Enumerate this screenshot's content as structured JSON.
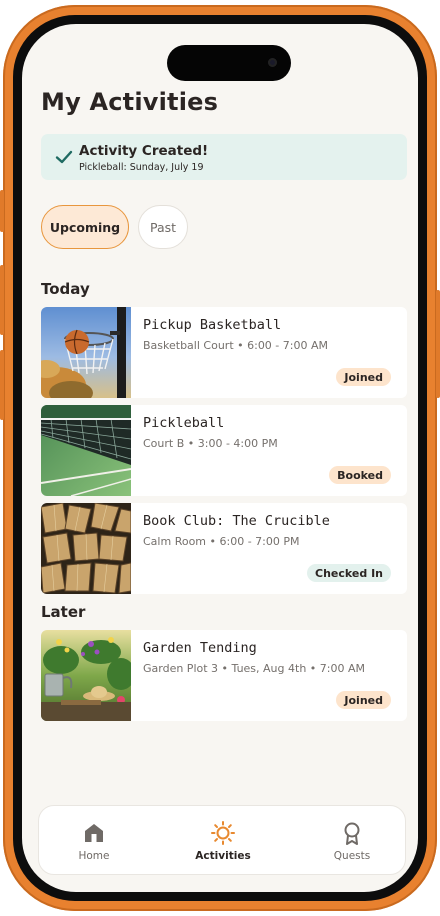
{
  "header": {
    "title": "My Activities"
  },
  "toast": {
    "title": "Activity Created!",
    "subtitle": "Pickleball: Sunday, July 19"
  },
  "filters": {
    "upcoming": "Upcoming",
    "past": "Past",
    "selected": "Upcoming"
  },
  "sections": {
    "today": {
      "label": "Today",
      "items": [
        {
          "title": "Pickup Basketball",
          "subtitle": "Basketball Court • 6:00 - 7:00 AM",
          "status": "Joined",
          "image_icon": "basketball-hoop"
        },
        {
          "title": "Pickleball",
          "subtitle": "Court B • 3:00 - 4:00 PM",
          "status": "Booked",
          "image_icon": "tennis-net"
        },
        {
          "title": "Book Club: The Crucible",
          "subtitle": "Calm Room • 6:00 - 7:00 PM",
          "status": "Checked In",
          "image_icon": "open-books"
        }
      ]
    },
    "later": {
      "label": "Later",
      "items": [
        {
          "title": "Garden Tending",
          "subtitle": "Garden Plot 3 • Tues, Aug 4th • 7:00 AM",
          "status": "Joined",
          "image_icon": "garden-flowers"
        }
      ]
    }
  },
  "nav": {
    "active": "Activities",
    "items": [
      {
        "label": "Home",
        "icon": "home-icon"
      },
      {
        "label": "Activities",
        "icon": "sun-icon"
      },
      {
        "label": "Quests",
        "icon": "award-icon"
      }
    ]
  },
  "colors": {
    "accent": "#e8963d",
    "frame": "#e8812f",
    "toast_bg": "#e4f2ee",
    "badge_orange": "#fde4cc",
    "badge_green": "#e3f1ed",
    "background": "#f8f6f2"
  }
}
